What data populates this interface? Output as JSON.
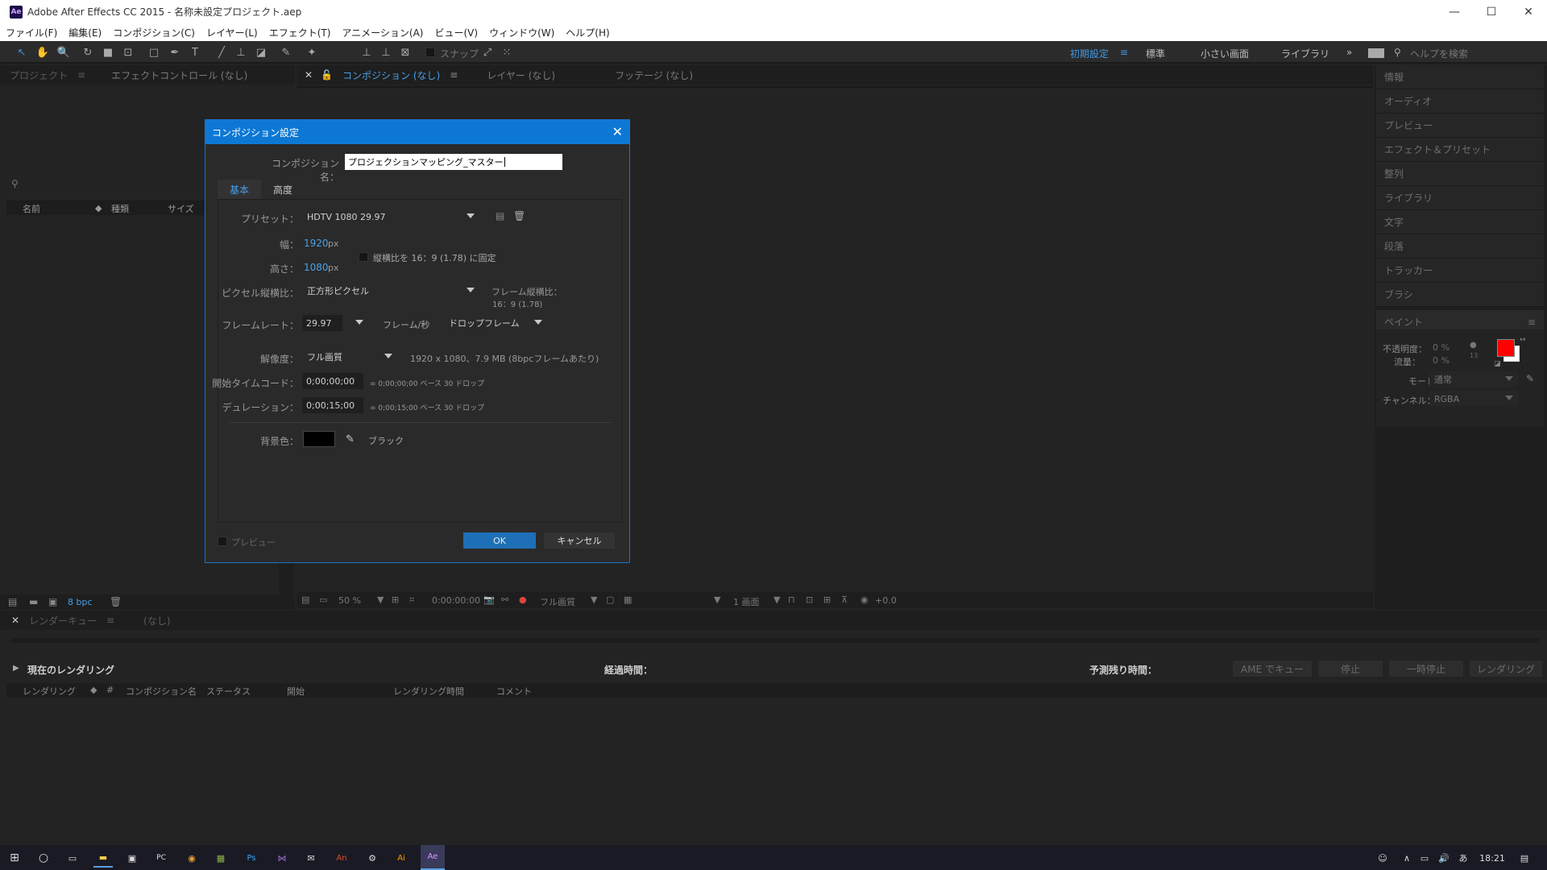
{
  "window": {
    "title": "Adobe After Effects CC 2015 - 名称未設定プロジェクト.aep",
    "app_icon": "Ae",
    "controls": [
      "—",
      "☐",
      "✕"
    ]
  },
  "menu": [
    "ファイル(F)",
    "編集(E)",
    "コンポジション(C)",
    "レイヤー(L)",
    "エフェクト(T)",
    "アニメーション(A)",
    "ビュー(V)",
    "ウィンドウ(W)",
    "ヘルプ(H)"
  ],
  "toolbar": {
    "snap_label": "スナップ",
    "workspaces": [
      "初期設定",
      "標準",
      "小さい画面",
      "ライブラリ"
    ],
    "search_placeholder": "ヘルプを検索"
  },
  "project_panel": {
    "tabs": [
      "プロジェクト",
      "エフェクトコントロール (なし)"
    ],
    "columns": [
      "名前",
      "種類",
      "サイズ"
    ],
    "bpc": "8 bpc"
  },
  "viewer": {
    "tabs": [
      "コンポジション (なし)",
      "レイヤー (なし)",
      "フッテージ (なし)"
    ],
    "zoom": "50 %",
    "timecode": "0:00:00:00",
    "resolution": "フル画質",
    "views": "1 画面",
    "exposure": "+0.0"
  },
  "right_panels": [
    "情報",
    "オーディオ",
    "プレビュー",
    "エフェクト＆プリセット",
    "整列",
    "ライブラリ",
    "文字",
    "段落",
    "トラッカー",
    "ブラシ"
  ],
  "paint_panel": {
    "title": "ペイント",
    "opacity_label": "不透明度：",
    "opacity_value": "0 %",
    "flow_label": "流量：",
    "flow_value": "0 %",
    "brush_size": "13",
    "mode_label": "モード：",
    "mode_value": "通常",
    "channel_label": "チャンネル：",
    "channel_value": "RGBA",
    "fg_color": "#ff0000",
    "bg_color": "#ffffff"
  },
  "render_queue": {
    "tabs": [
      "レンダーキュー",
      "(なし)"
    ],
    "current_render": "現在のレンダリング",
    "elapsed_label": "経過時間：",
    "remaining_label": "予測残り時間：",
    "buttons": [
      "AME でキュー",
      "停止",
      "一時停止",
      "レンダリング"
    ],
    "columns": [
      "レンダリング",
      "#",
      "コンポジション名",
      "ステータス",
      "開始",
      "レンダリング時間",
      "コメント"
    ]
  },
  "dialog": {
    "title": "コンポジション設定",
    "comp_name_label": "コンポジション名：",
    "comp_name_value": "プロジェクションマッピング_マスター",
    "tabs": [
      "基本",
      "高度"
    ],
    "preset_label": "プリセット：",
    "preset_value": "HDTV 1080 29.97",
    "width_label": "幅：",
    "width_value": "1920",
    "height_label": "高さ：",
    "height_value": "1080",
    "px": "px",
    "lock_aspect": "縦横比を 16：9 (1.78) に固定",
    "pixel_aspect_label": "ピクセル縦横比：",
    "pixel_aspect_value": "正方形ピクセル",
    "frame_aspect_label": "フレーム縦横比：",
    "frame_aspect_value": "16：9 (1.78)",
    "frame_rate_label": "フレームレート：",
    "frame_rate_value": "29.97",
    "fps_label": "フレーム/秒",
    "drop_frame": "ドロップフレーム",
    "resolution_label": "解像度：",
    "resolution_value": "フル画質",
    "resolution_info": "1920 x 1080、7.9 MB (8bpcフレームあたり)",
    "start_tc_label": "開始タイムコード：",
    "start_tc_value": "0;00;00;00",
    "start_tc_info": "= 0;00;00;00  ベース  30  ドロップ",
    "duration_label": "デュレーション：",
    "duration_value": "0;00;15;00",
    "duration_info": "= 0;00;15;00  ベース  30  ドロップ",
    "bg_color_label": "背景色：",
    "bg_color_name": "ブラック",
    "bg_color": "#000000",
    "preview_label": "プレビュー",
    "ok": "OK",
    "cancel": "キャンセル"
  },
  "taskbar": {
    "time": "18:21",
    "ime": "あ"
  }
}
